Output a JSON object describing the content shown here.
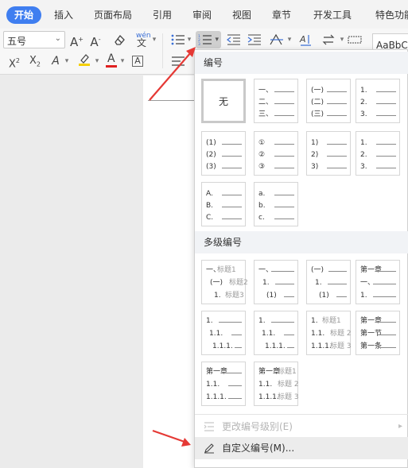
{
  "menubar": {
    "tabs": [
      {
        "label": "开始",
        "active": true
      },
      {
        "label": "插入"
      },
      {
        "label": "页面布局"
      },
      {
        "label": "引用"
      },
      {
        "label": "审阅"
      },
      {
        "label": "视图"
      },
      {
        "label": "章节"
      },
      {
        "label": "开发工具"
      },
      {
        "label": "特色功能"
      }
    ]
  },
  "ribbon": {
    "font_size": {
      "value": "五号"
    },
    "style_preview": "AaBbCc"
  },
  "numbering_panel": {
    "section_numbering": "编号",
    "section_multilevel": "多级编号",
    "none_label": "无",
    "single_level": [
      {
        "lines": [
          "一、",
          "二、",
          "三、"
        ]
      },
      {
        "lines": [
          "(一)",
          "(二)",
          "(三)"
        ]
      },
      {
        "lines": [
          "1.",
          "2.",
          "3."
        ]
      },
      {
        "lines": [
          "(1)",
          "(2)",
          "(3)"
        ]
      },
      {
        "lines": [
          "①",
          "②",
          "③"
        ]
      },
      {
        "lines": [
          "1)",
          "2)",
          "3)"
        ]
      },
      {
        "lines": [
          "1.",
          "2.",
          "3."
        ]
      },
      {
        "lines": [
          "A.",
          "B.",
          "C."
        ]
      },
      {
        "lines": [
          "a.",
          "b.",
          "c."
        ]
      }
    ],
    "multi_level": [
      {
        "lines": [
          {
            "n": "一、",
            "t": "标题1"
          },
          {
            "n": "(一)",
            "t": "标题2"
          },
          {
            "n": "1.",
            "t": "标题3"
          }
        ]
      },
      {
        "lines": [
          {
            "n": "一、",
            "t": ""
          },
          {
            "n": "1.",
            "t": ""
          },
          {
            "n": "(1)",
            "t": ""
          }
        ]
      },
      {
        "lines": [
          {
            "n": "(一)",
            "t": ""
          },
          {
            "n": "1.",
            "t": ""
          },
          {
            "n": "(1)",
            "t": ""
          }
        ]
      },
      {
        "lines": [
          {
            "n": "第一章",
            "t": ""
          },
          {
            "n": "一、",
            "t": ""
          },
          {
            "n": "1.",
            "t": ""
          }
        ]
      },
      {
        "lines": [
          {
            "n": "1.",
            "t": ""
          },
          {
            "n": "1.1.",
            "t": ""
          },
          {
            "n": "1.1.1.",
            "t": ""
          }
        ]
      },
      {
        "lines": [
          {
            "n": "1.",
            "t": ""
          },
          {
            "n": "1.1.",
            "t": ""
          },
          {
            "n": "1.1.1.",
            "t": ""
          }
        ]
      },
      {
        "lines": [
          {
            "n": "1.",
            "t": "标题1"
          },
          {
            "n": "1.1.",
            "t": "标题 2"
          },
          {
            "n": "1.1.1.",
            "t": "标题 3"
          }
        ]
      },
      {
        "lines": [
          {
            "n": "第一章",
            "t": ""
          },
          {
            "n": "第一节",
            "t": ""
          },
          {
            "n": "第一条",
            "t": ""
          }
        ]
      },
      {
        "lines": [
          {
            "n": "第一章",
            "t": ""
          },
          {
            "n": "1.1.",
            "t": ""
          },
          {
            "n": "1.1.1.",
            "t": ""
          }
        ]
      },
      {
        "lines": [
          {
            "n": "第一章",
            "t": "标题1"
          },
          {
            "n": "1.1.",
            "t": "标题 2"
          },
          {
            "n": "1.1.1.",
            "t": "标题 3"
          }
        ]
      }
    ],
    "actions": {
      "change_level": "更改编号级别(E)",
      "custom": "自定义编号(M)..."
    }
  },
  "colors": {
    "accent": "#3f7ef0",
    "highlight_yellow": "#f5d000",
    "font_color_red": "#e02020",
    "annotation_arrow": "#e53935"
  }
}
